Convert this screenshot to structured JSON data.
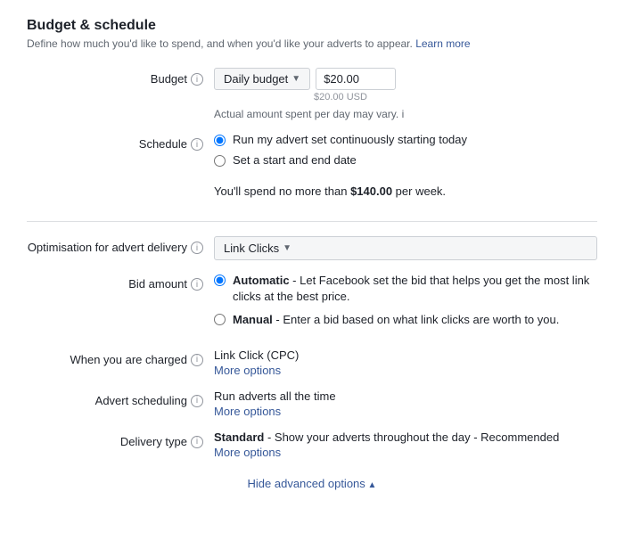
{
  "page": {
    "title": "Budget & schedule",
    "description": "Define how much you'd like to spend, and when you'd like your adverts to appear.",
    "learn_more": "Learn more"
  },
  "budget": {
    "label": "Budget",
    "dropdown_label": "Daily budget",
    "input_value": "$20.00",
    "usd_label": "$20.00 USD",
    "note": "Actual amount spent per day may vary.",
    "spend_note_prefix": "You'll spend no more than ",
    "spend_amount": "$140.00",
    "spend_note_suffix": " per week."
  },
  "schedule": {
    "label": "Schedule",
    "option1": "Run my advert set continuously starting today",
    "option2": "Set a start and end date"
  },
  "optimisation": {
    "label": "Optimisation for advert delivery",
    "dropdown_label": "Link Clicks"
  },
  "bid_amount": {
    "label": "Bid amount",
    "option1_label": "Automatic",
    "option1_desc": " - Let Facebook set the bid that helps you get the most link clicks at the best price.",
    "option2_label": "Manual",
    "option2_desc": " - Enter a bid based on what link clicks are worth to you."
  },
  "when_charged": {
    "label": "When you are charged",
    "value": "Link Click (CPC)",
    "more_options": "More options"
  },
  "advert_scheduling": {
    "label": "Advert scheduling",
    "value": "Run adverts all the time",
    "more_options": "More options"
  },
  "delivery_type": {
    "label": "Delivery type",
    "value_label": "Standard",
    "value_desc": " - Show your adverts throughout the day - Recommended",
    "more_options": "More options"
  },
  "hide_advanced": "Hide advanced options"
}
